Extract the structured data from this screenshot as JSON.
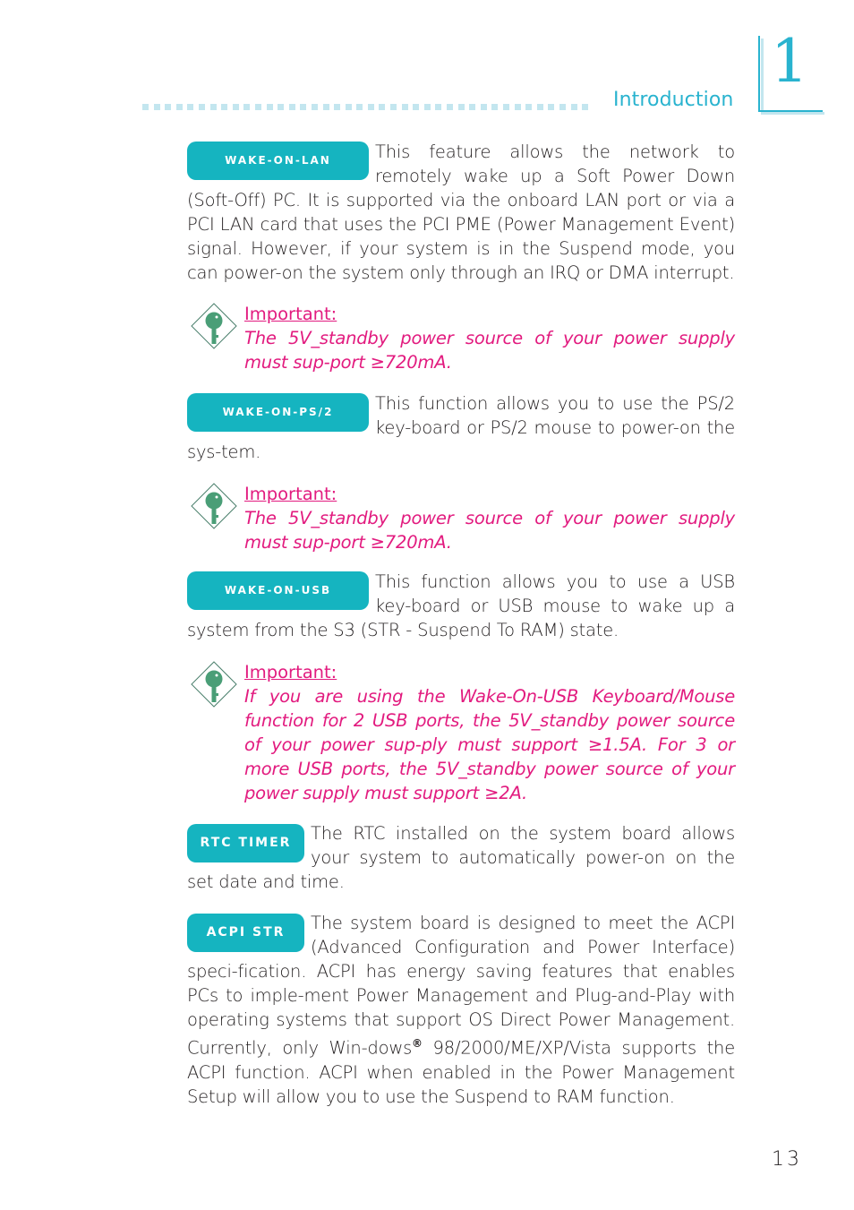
{
  "header": {
    "chapter_title": "Introduction",
    "chapter_number": "1",
    "accent_color": "#29b3cf"
  },
  "sections": [
    {
      "badge": "Wake-On-LAN",
      "text": "This feature allows the network to remotely wake up a Soft Power Down (Soft-Off) PC. It is supported via the onboard LAN port or via a PCI LAN card that uses the PCI PME (Power Management Event) signal. However, if your system is in the Suspend mode, you can power-on the system only through an IRQ or DMA interrupt."
    },
    {
      "badge": "Wake-On-PS/2",
      "text": "This function allows you to use the PS/2 key-board or PS/2 mouse to power-on the sys-tem."
    },
    {
      "badge": "Wake-On-USB",
      "text": "This function allows you to use a USB key-board or USB mouse to wake up a system from the S3 (STR - Suspend To RAM) state."
    },
    {
      "badge": "RTC Timer",
      "text": "The RTC installed on the system board allows your system to automatically power-on on the set date and time."
    },
    {
      "badge": "ACPI STR",
      "text_before_mark": "The system board is designed to meet the ACPI (Advanced Configuration and Power Interface) speci-fication. ACPI has energy saving features that enables PCs to imple-ment Power Management and Plug-and-Play with operating systems that support OS Direct Power Management. Currently, only Win-dows",
      "registered_mark": "®",
      "text_after_mark": " 98/2000/ME/XP/Vista supports the ACPI function. ACPI when enabled in the Power Management Setup will allow you to use the Suspend to RAM function."
    }
  ],
  "notes": [
    {
      "title": "Important:",
      "text": "The 5V_standby power source of your power supply must sup-port ≥720mA."
    },
    {
      "title": "Important:",
      "text": "The 5V_standby power source of your power supply must sup-port ≥720mA."
    },
    {
      "title": "Important:",
      "text": "If you are using the Wake-On-USB Keyboard/Mouse function for 2 USB ports, the 5V_standby power source of your power sup-ply must support ≥1.5A. For 3 or more USB ports, the 5V_standby power source of your power supply must support ≥2A."
    }
  ],
  "footer": {
    "page_number": "13"
  },
  "colors": {
    "badge": "#15b4c0",
    "important": "#e21b7f",
    "key_icon": "#4a9e77"
  }
}
